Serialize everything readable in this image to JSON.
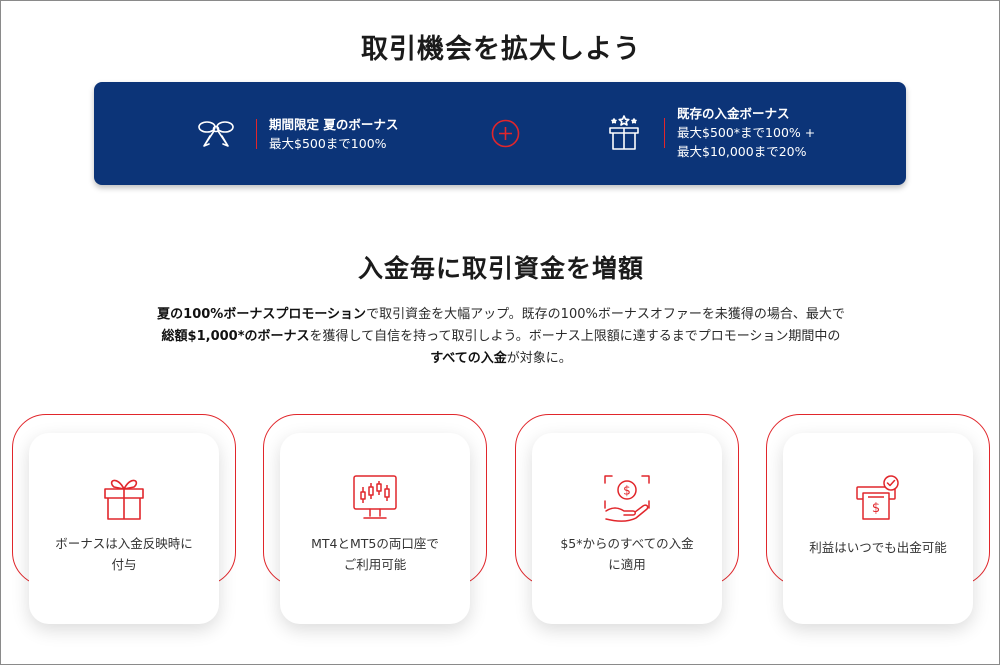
{
  "headings": {
    "top": "取引機会を拡大しよう",
    "second": "入金毎に取引資金を増額"
  },
  "banner": {
    "bonus1": {
      "title": "期間限定 夏のボーナス",
      "line1": "最大$500まで100%",
      "icon": "ribbon-bow-icon"
    },
    "bonus2": {
      "title": "既存の入金ボーナス",
      "line1": "最大$500*まで100% +",
      "line2": "最大$10,000まで20%",
      "icon": "gift-box-stars-icon"
    },
    "plus_icon": "plus-circle-icon"
  },
  "description": {
    "b1": "夏の100%ボーナスプロモーション",
    "t1": "で取引資金を大幅アップ。既存の100%ボーナスオファーを未獲得の場合、最大で",
    "b2": "総額$1,000*のボーナス",
    "t2": "を獲得して自信を持って取引しよう。ボーナス上限額に達するまでプロモーション期間中の",
    "b3": "すべての入金",
    "t3": "が対象に。"
  },
  "features": [
    {
      "line1": "ボーナスは入金反映時に",
      "line2": "付与",
      "icon": "gift-icon"
    },
    {
      "line1": "MT4とMT5の両口座で",
      "line2": "ご利用可能",
      "icon": "candlestick-chart-icon"
    },
    {
      "line1": "$5*からのすべての入金",
      "line2": "に適用",
      "icon": "coin-hand-icon"
    },
    {
      "line1": "利益はいつでも出金可能",
      "line2": "",
      "icon": "withdraw-check-icon"
    }
  ],
  "colors": {
    "banner_bg": "#0c3478",
    "accent_red": "#e1262b",
    "text_dark": "#1b1b1b"
  }
}
